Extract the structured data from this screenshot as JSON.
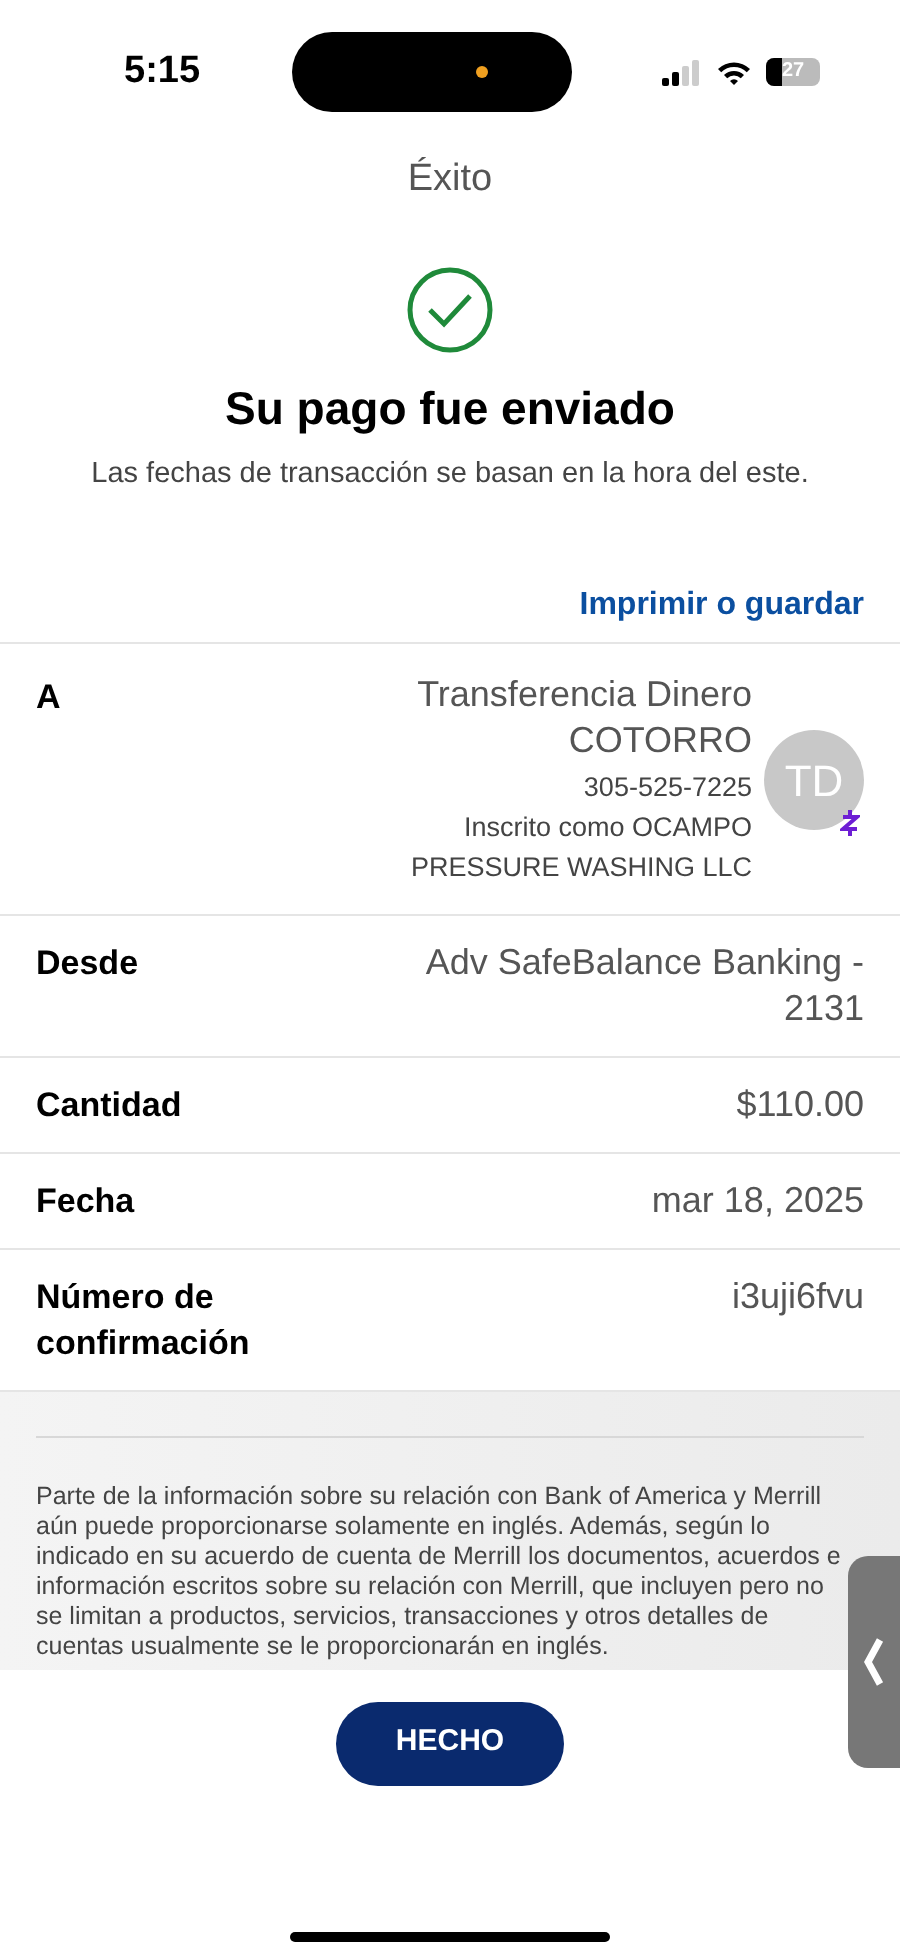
{
  "status_bar": {
    "time": "5:15",
    "battery": "27"
  },
  "header": {
    "title": "Éxito"
  },
  "confirmation": {
    "heading": "Su pago fue enviado",
    "subtitle": "Las fechas de transacción se basan en la hora del este."
  },
  "print_link": "Imprimir o guardar",
  "recipient": {
    "label": "A",
    "name_lines": [
      "Transferencia Dinero",
      "COTORRO"
    ],
    "phone": "305-525-7225",
    "enrolled_lines": [
      "Inscrito como OCAMPO",
      "PRESSURE WASHING LLC"
    ],
    "avatar_initials": "TD"
  },
  "details": [
    {
      "label": "Desde",
      "value": "Adv SafeBalance Banking - 2131"
    },
    {
      "label": "Cantidad",
      "value": "$110.00"
    },
    {
      "label": "Fecha",
      "value": "mar 18, 2025"
    },
    {
      "label": "Número de confirmación",
      "value": "i3uji6fvu"
    }
  ],
  "disclaimer": "Parte de la información sobre su relación con Bank of America y Merrill aún puede proporcionarse solamente en inglés. Además, según lo indicado en su acuerdo de cuenta de Merrill los documentos, acuerdos e información escritos sobre su relación con Merrill, que incluyen pero no se limitan a productos, servicios, transacciones y otros detalles de cuentas usualmente se le proporcionarán en inglés.",
  "done_button": "HECHO"
}
